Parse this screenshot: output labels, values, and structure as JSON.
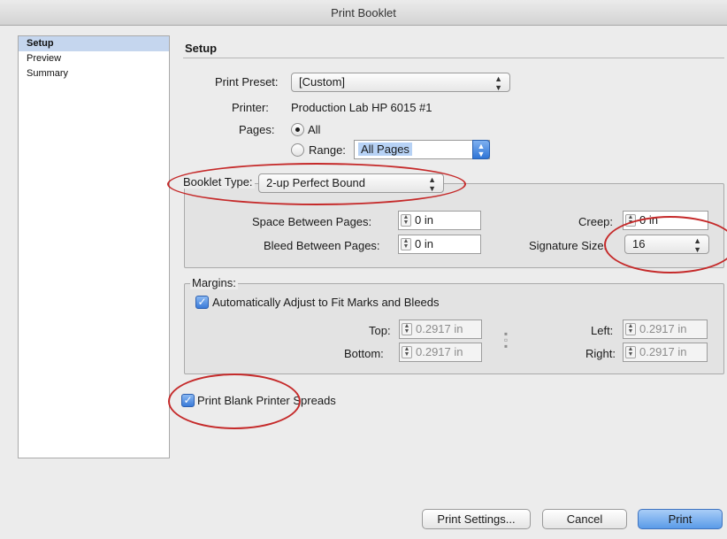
{
  "window": {
    "title": "Print Booklet"
  },
  "sidebar": {
    "items": [
      {
        "label": "Setup",
        "selected": true
      },
      {
        "label": "Preview",
        "selected": false
      },
      {
        "label": "Summary",
        "selected": false
      }
    ]
  },
  "setup": {
    "section_title": "Setup",
    "print_preset": {
      "label": "Print Preset:",
      "value": "[Custom]"
    },
    "printer": {
      "label": "Printer:",
      "value": "Production Lab HP 6015 #1"
    },
    "pages": {
      "label": "Pages:",
      "all_label": "All",
      "range_label": "Range:",
      "range_value": "All Pages",
      "selected": "All"
    }
  },
  "booklet": {
    "type_label": "Booklet Type:",
    "type_value": "2-up Perfect Bound",
    "space_label": "Space Between Pages:",
    "space_value": "0 in",
    "bleed_label": "Bleed Between Pages:",
    "bleed_value": "0 in",
    "creep_label": "Creep:",
    "creep_value": "0 in",
    "signature_label": "Signature Size:",
    "signature_value": "16"
  },
  "margins": {
    "legend": "Margins:",
    "auto_label": "Automatically Adjust to Fit Marks and Bleeds",
    "auto_checked": true,
    "top_label": "Top:",
    "top_value": "0.2917 in",
    "bottom_label": "Bottom:",
    "bottom_value": "0.2917 in",
    "left_label": "Left:",
    "left_value": "0.2917 in",
    "right_label": "Right:",
    "right_value": "0.2917 in"
  },
  "blank_spreads": {
    "label": "Print Blank Printer Spreads",
    "checked": true
  },
  "buttons": {
    "print_settings": "Print Settings...",
    "cancel": "Cancel",
    "print": "Print"
  },
  "colors": {
    "annotation": "#c52a2a",
    "selection": "#c5d6ee",
    "accent": "#3a7bd8"
  }
}
